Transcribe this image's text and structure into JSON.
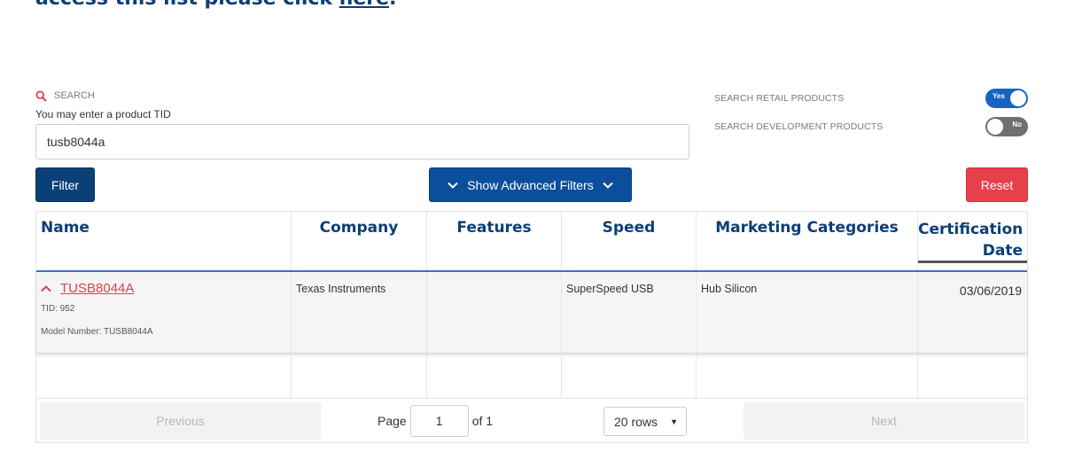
{
  "heading": {
    "prefix": "access this list please click ",
    "link": "here",
    "suffix": "."
  },
  "search": {
    "section_label": "SEARCH",
    "hint": "You may enter a product TID",
    "value": "tusb8044a"
  },
  "toggles": [
    {
      "label": "SEARCH RETAIL PRODUCTS",
      "state_label": "Yes",
      "on": true
    },
    {
      "label": "SEARCH DEVELOPMENT PRODUCTS",
      "state_label": "No",
      "on": false
    }
  ],
  "buttons": {
    "filter": "Filter",
    "advanced": "Show Advanced Filters",
    "reset": "Reset"
  },
  "table": {
    "columns": [
      "Name",
      "Company",
      "Features",
      "Speed",
      "Marketing Categories",
      "Certification",
      "Date"
    ],
    "rows": [
      {
        "name": "TUSB8044A",
        "tid": "TID: 952",
        "model": "Model Number: TUSB8044A",
        "company": "Texas Instruments",
        "features": "",
        "speed": "SuperSpeed USB",
        "marketing": "Hub Silicon",
        "cert_date": "03/06/2019"
      }
    ]
  },
  "pagination": {
    "previous": "Previous",
    "page_label": "Page",
    "page_value": "1",
    "of_label": "of 1",
    "rows_select": "20 rows",
    "next": "Next"
  },
  "colors": {
    "navy": "#0b3f78",
    "button_blue": "#0b4f9c",
    "reset_red": "#e8404b",
    "link_red": "#d9434e",
    "toggle_on": "#1565c0",
    "toggle_off": "#6f6f6f"
  },
  "icons": {
    "search": "search-icon",
    "advanced": "chevron-down-icon",
    "row_toggle": "chevron-up-icon"
  }
}
